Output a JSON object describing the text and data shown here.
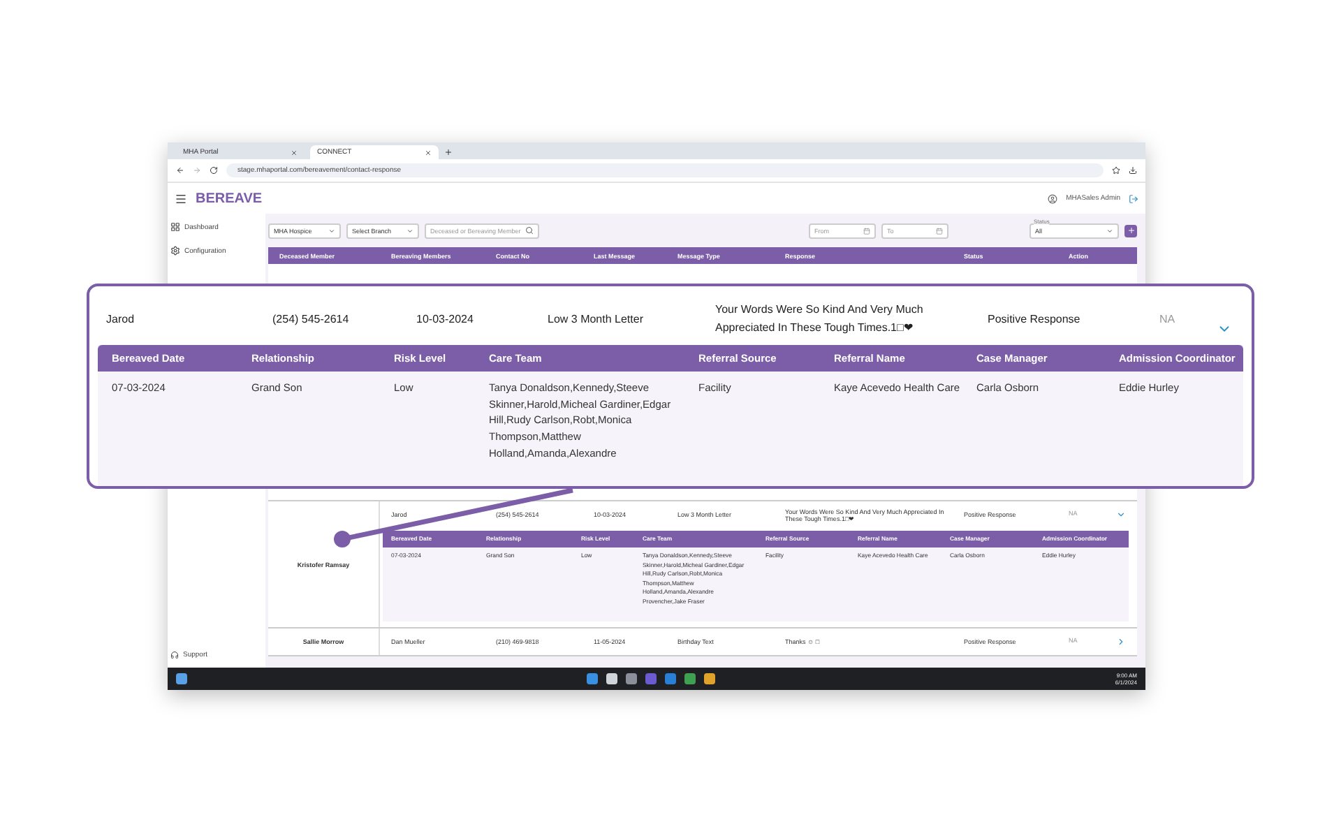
{
  "browser": {
    "tabs": [
      {
        "label": "MHA Portal",
        "selected": false
      },
      {
        "label": "CONNECT",
        "selected": true
      }
    ],
    "url": "stage.mhaportal.com/bereavement/contact-response"
  },
  "app": {
    "title": "BEREAVE",
    "user": "MHASales Admin"
  },
  "sidebar": {
    "items": [
      {
        "label": "Dashboard",
        "kind": "grid"
      },
      {
        "label": "Configuration",
        "kind": "gear"
      }
    ],
    "footer": "Support"
  },
  "filters": {
    "hospice": "MHA Hospice",
    "branch": "Select Branch",
    "search_placeholder": "Deceased or Bereaving Member",
    "from_placeholder": "From",
    "to_placeholder": "To",
    "status_label": "Status",
    "status_value": "All"
  },
  "table": {
    "columns": [
      "Deceased Member",
      "Bereaving Members",
      "Contact No",
      "Last Message",
      "Message Type",
      "Response",
      "Status",
      "Action"
    ],
    "detail_columns": [
      "Bereaved Date",
      "Relationship",
      "Risk Level",
      "Care Team",
      "Referral Source",
      "Referral Name",
      "Case Manager",
      "Admission Coordinator"
    ],
    "groups": [
      {
        "deceased": "Kristofer Ramsay",
        "contacts": [
          {
            "member": "Jarod",
            "contact": "(254) 545-2614",
            "last_message": "10-03-2024",
            "message_type": "Low 3 Month Letter",
            "response": "Your Words Were So Kind And Very Much Appreciated In These Tough Times.1□❤",
            "status": "Positive Response",
            "action": "NA",
            "expanded": true,
            "details": [
              "07-03-2024",
              "Grand Son",
              "Low",
              "Tanya Donaldson,Kennedy,Steeve Skinner,Harold,Micheal Gardiner,Edgar Hill,Rudy Carlson,Robt,Monica Thompson,Matthew Holland,Amanda,Alexandre Provencher,Jake Fraser",
              "Facility",
              "Kaye Acevedo Health Care",
              "Carla Osborn",
              "Eddie Hurley"
            ]
          }
        ]
      },
      {
        "deceased": "Sallie Morrow",
        "contacts": [
          {
            "member": "Dan Mueller",
            "contact": "(210) 469-9818",
            "last_message": "11-05-2024",
            "message_type": "Birthday Text",
            "response": "Thanks ☺ □",
            "status": "Positive Response",
            "action": "NA",
            "expanded": false
          }
        ]
      }
    ]
  },
  "callout": {
    "detail_columns": [
      "Bereaved Date",
      "Relationship",
      "Risk Level",
      "Care Team",
      "Referral Source",
      "Referral Name",
      "Case Manager",
      "Admission Coordinator"
    ],
    "member": "Jarod",
    "contact": "(254) 545-2614",
    "last_message": "10-03-2024",
    "message_type": "Low 3 Month Letter",
    "response": "Your Words Were So Kind And Very Much Appreciated In These Tough Times.1□❤",
    "status": "Positive Response",
    "action": "NA",
    "expanded": true,
    "details": [
      "07-03-2024",
      "Grand Son",
      "Low",
      "Tanya Donaldson,Kennedy,Steeve Skinner,Harold,Micheal Gardiner,Edgar Hill,Rudy Carlson,Robt,Monica Thompson,Matthew Holland,Amanda,Alexandre",
      "Facility",
      "Kaye Acevedo Health Care",
      "Carla Osborn",
      "Eddie Hurley"
    ]
  },
  "taskbar": {
    "time": "9:00 AM",
    "date": "6/1/2024"
  }
}
